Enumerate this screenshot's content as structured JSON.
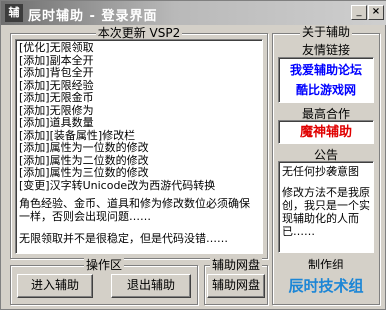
{
  "window": {
    "icon_text": "辅",
    "title": "辰时辅助 - 登录界面",
    "min_label": "_",
    "close_label": "×"
  },
  "update": {
    "header": "本次更新 VSP2",
    "lines": [
      "[优化]无限领取",
      "[添加]副本全开",
      "[添加]背包全开",
      "[添加]无限经验",
      "[添加]无限金币",
      "[添加]无限修为",
      "[添加]道具数量",
      "[添加][装备属性]修改栏",
      "[添加]属性为一位数的修改",
      "[添加]属性为二位数的修改",
      "[添加]属性为三位数的修改",
      "[变更]汉字转Unicode改为西游代码转换"
    ],
    "para1": "角色经验、金币、道具和修为修改数位必须确保一样，否则会出现问题……",
    "para2": "无限领取并不是很稳定，但是代码没错……"
  },
  "ops": {
    "title": "操作区",
    "enter_label": "进入辅助",
    "exit_label": "退出辅助"
  },
  "netdisk": {
    "title": "辅助网盘",
    "button_label": "辅助网盘"
  },
  "about": {
    "title": "关于辅助",
    "friends_title": "友情链接",
    "link1": "我爱辅助论坛",
    "link2": "酷比游戏网",
    "sponsor_title": "最高合作",
    "sponsor": "魔神辅助",
    "notice_title": "公告",
    "notice_line1": "无任何抄袭意图",
    "notice_line2": "修改方法不是我原创，我只是一个实现辅助化的人而已……",
    "maker_title": "制作组",
    "maker": "辰时技术组"
  }
}
